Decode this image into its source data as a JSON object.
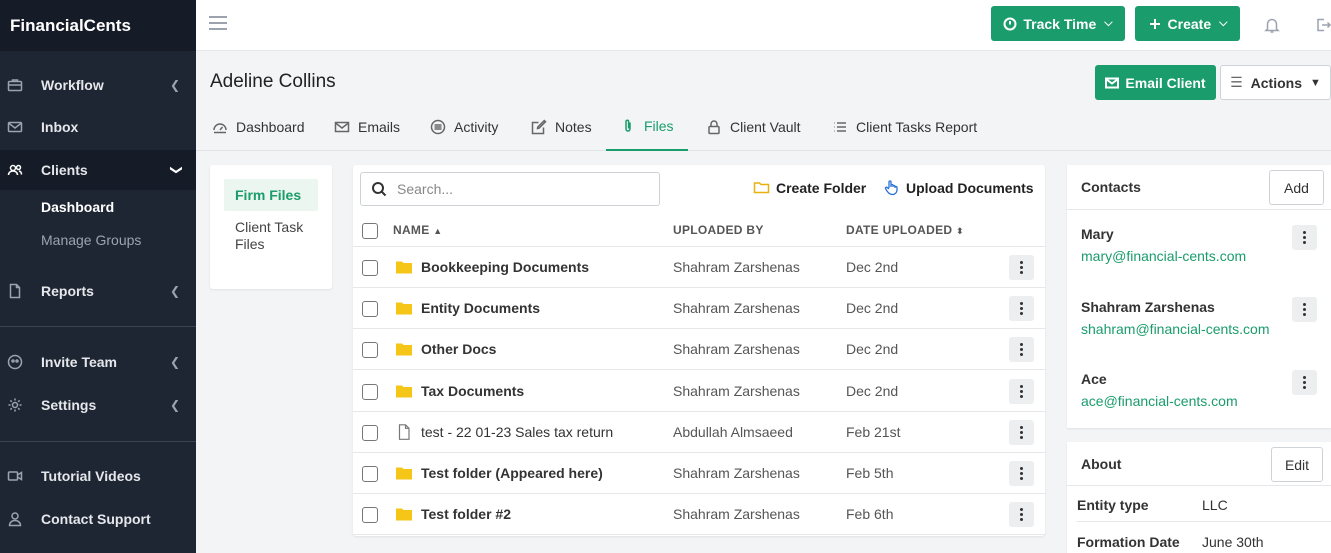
{
  "brand": "FinancialCents",
  "sidebar": {
    "items": [
      {
        "label": "Workflow",
        "icon": "briefcase-icon"
      },
      {
        "label": "Inbox",
        "icon": "mail-icon"
      },
      {
        "label": "Clients",
        "icon": "users-icon"
      },
      {
        "label": "Reports",
        "icon": "file-icon"
      },
      {
        "label": "Invite Team",
        "icon": "group-icon"
      },
      {
        "label": "Settings",
        "icon": "gear-icon"
      },
      {
        "label": "Tutorial Videos",
        "icon": "video-icon"
      },
      {
        "label": "Contact Support",
        "icon": "person-icon"
      }
    ],
    "sub_items": [
      "Dashboard",
      "Manage Groups"
    ]
  },
  "topbar": {
    "track_time": "Track Time",
    "create": "Create"
  },
  "client": {
    "name": "Adeline Collins",
    "email_client": "Email Client",
    "actions": "Actions"
  },
  "tabs": [
    {
      "label": "Dashboard",
      "icon": "dashboard-icon"
    },
    {
      "label": "Emails",
      "icon": "envelope-icon"
    },
    {
      "label": "Activity",
      "icon": "activity-icon"
    },
    {
      "label": "Notes",
      "icon": "edit-icon"
    },
    {
      "label": "Files",
      "icon": "paperclip-icon"
    },
    {
      "label": "Client Vault",
      "icon": "lock-icon"
    },
    {
      "label": "Client Tasks Report",
      "icon": "list-icon"
    }
  ],
  "files_nav": {
    "firm_files": "Firm Files",
    "client_task_files": "Client Task Files"
  },
  "files": {
    "search_placeholder": "Search...",
    "create_folder": "Create Folder",
    "upload_documents": "Upload Documents",
    "columns": {
      "name": "NAME",
      "uploaded_by": "UPLOADED BY",
      "date_uploaded": "DATE UPLOADED"
    },
    "rows": [
      {
        "name": "Bookkeeping Documents",
        "type": "folder",
        "by": "Shahram Zarshenas",
        "date": "Dec 2nd"
      },
      {
        "name": "Entity Documents",
        "type": "folder",
        "by": "Shahram Zarshenas",
        "date": "Dec 2nd"
      },
      {
        "name": "Other Docs",
        "type": "folder",
        "by": "Shahram Zarshenas",
        "date": "Dec 2nd"
      },
      {
        "name": "Tax Documents",
        "type": "folder",
        "by": "Shahram Zarshenas",
        "date": "Dec 2nd"
      },
      {
        "name": "test - 22 01-23 Sales tax return",
        "type": "file",
        "by": "Abdullah Almsaeed",
        "date": "Feb 21st"
      },
      {
        "name": "Test folder (Appeared here)",
        "type": "folder",
        "by": "Shahram Zarshenas",
        "date": "Feb 5th"
      },
      {
        "name": "Test folder #2",
        "type": "folder",
        "by": "Shahram Zarshenas",
        "date": "Feb 6th"
      }
    ]
  },
  "contacts": {
    "title": "Contacts",
    "add": "Add",
    "list": [
      {
        "name": "Mary",
        "email": "mary@financial-cents.com"
      },
      {
        "name": "Shahram Zarshenas",
        "email": "shahram@financial-cents.com"
      },
      {
        "name": "Ace",
        "email": "ace@financial-cents.com"
      }
    ]
  },
  "about": {
    "title": "About",
    "edit": "Edit",
    "fields": [
      {
        "key": "Entity type",
        "value": "LLC"
      },
      {
        "key": "Formation Date",
        "value": "June 30th"
      }
    ]
  },
  "colors": {
    "accent": "#1a9c6c",
    "sidebar_bg": "#1f2633",
    "folder": "#f5c518"
  }
}
